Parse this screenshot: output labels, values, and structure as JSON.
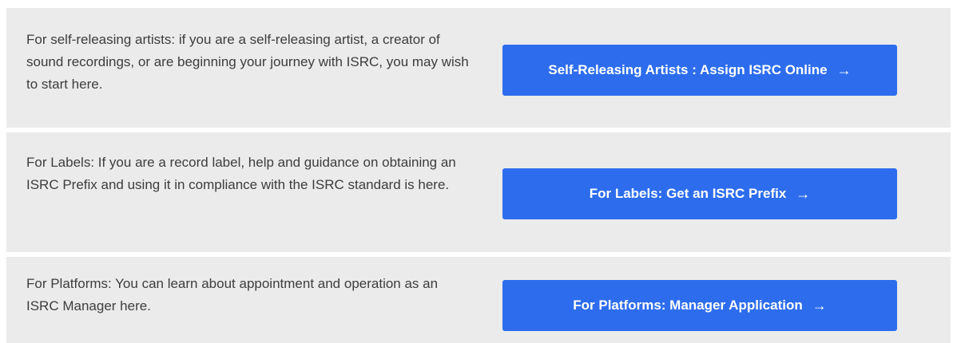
{
  "panels": [
    {
      "text": "For self-releasing artists: if you are a self-releasing artist, a creator of sound recordings, or are beginning your journey with ISRC, you may wish to start here.",
      "button_label": "Self-Releasing Artists : Assign ISRC Online",
      "button_icon": "arrow-right-icon"
    },
    {
      "text": "For Labels: If you are a record label, help and guidance on obtaining an ISRC Prefix and using it in compliance with the ISRC standard is here.",
      "button_label": "For Labels: Get an ISRC Prefix",
      "button_icon": "arrow-right-icon"
    },
    {
      "text": "For Platforms: You can learn about appointment and operation as an ISRC Manager here.",
      "button_label": "For Platforms: Manager Application",
      "button_icon": "arrow-right-icon"
    }
  ],
  "colors": {
    "panel_background": "#ebebeb",
    "button_background": "#2d6ded",
    "button_text": "#ffffff",
    "body_text": "#3d3d3d"
  }
}
